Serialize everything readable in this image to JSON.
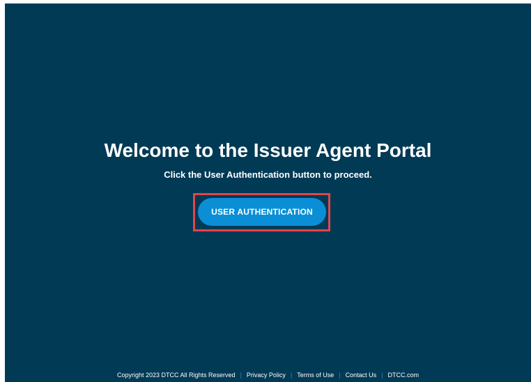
{
  "main": {
    "title": "Welcome to the Issuer Agent Portal",
    "subtitle": "Click the User Authentication button to proceed.",
    "auth_button_label": "USER AUTHENTICATION"
  },
  "footer": {
    "copyright": "Copyright 2023 DTCC All Rights Reserved",
    "links": [
      "Privacy Policy",
      "Terms of Use",
      "Contact Us",
      "DTCC.com"
    ],
    "separator": "|"
  },
  "colors": {
    "background": "#003a55",
    "button": "#0a8fd6",
    "highlight": "#e0464c",
    "separator": "#2f8cc4"
  }
}
